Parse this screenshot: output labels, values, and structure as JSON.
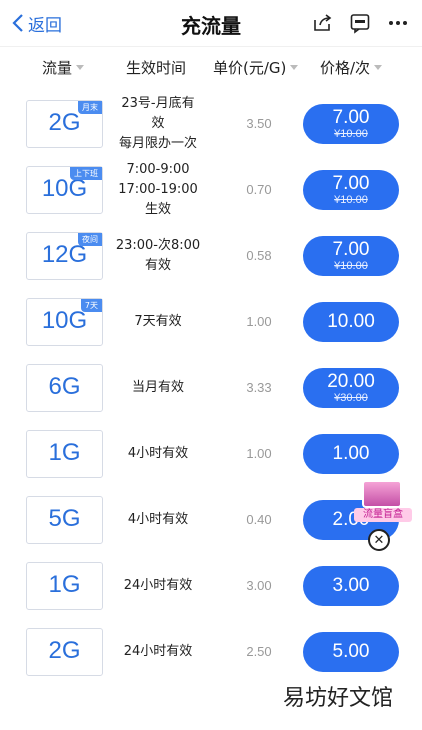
{
  "topbar": {
    "back_label": "返回",
    "title": "充流量",
    "icons": [
      "share-icon",
      "feedback-icon",
      "more-icon"
    ]
  },
  "columns": {
    "flow": "流量",
    "effective_time": "生效时间",
    "unit_price": "单价(元/G)",
    "price": "价格/次"
  },
  "items": [
    {
      "amount": "2G",
      "tag": "月末",
      "eff": [
        "23号-月底有",
        "效",
        "每月限办一次"
      ],
      "unit": "3.50",
      "price": "7.00",
      "orig": "¥10.00"
    },
    {
      "amount": "10G",
      "tag": "上下班",
      "eff": [
        "7:00-9:00",
        "17:00-19:00",
        "生效"
      ],
      "unit": "0.70",
      "price": "7.00",
      "orig": "¥10.00"
    },
    {
      "amount": "12G",
      "tag": "夜间",
      "eff": [
        "23:00-次8:00",
        "有效"
      ],
      "unit": "0.58",
      "price": "7.00",
      "orig": "¥10.00"
    },
    {
      "amount": "10G",
      "tag": "7天",
      "eff": [
        "7天有效"
      ],
      "unit": "1.00",
      "price": "10.00",
      "orig": ""
    },
    {
      "amount": "6G",
      "tag": "",
      "eff": [
        "当月有效"
      ],
      "unit": "3.33",
      "price": "20.00",
      "orig": "¥30.00"
    },
    {
      "amount": "1G",
      "tag": "",
      "eff": [
        "4小时有效"
      ],
      "unit": "1.00",
      "price": "1.00",
      "orig": ""
    },
    {
      "amount": "5G",
      "tag": "",
      "eff": [
        "4小时有效"
      ],
      "unit": "0.40",
      "price": "2.00",
      "orig": ""
    },
    {
      "amount": "1G",
      "tag": "",
      "eff": [
        "24小时有效"
      ],
      "unit": "3.00",
      "price": "3.00",
      "orig": ""
    },
    {
      "amount": "2G",
      "tag": "",
      "eff": [
        "24小时有效"
      ],
      "unit": "2.50",
      "price": "5.00",
      "orig": ""
    }
  ],
  "blind_box": {
    "label": "流量盲盒"
  },
  "watermark": "易坊好文馆",
  "colors": {
    "accent": "#2a6ff0",
    "tile_border": "#d6dbe5",
    "tag": "#4b8cf0"
  }
}
